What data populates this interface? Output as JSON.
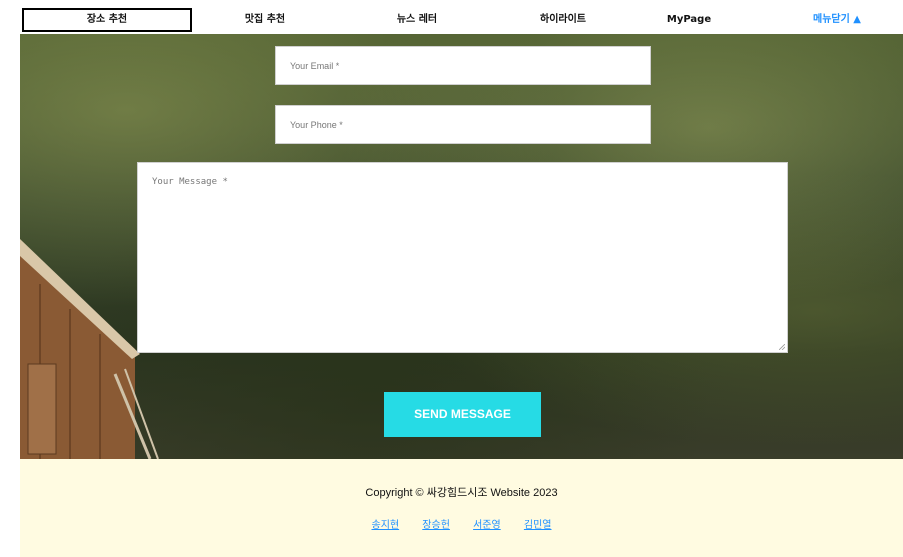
{
  "nav": {
    "items": [
      {
        "label": "장소 추천"
      },
      {
        "label": "맛집 추천"
      },
      {
        "label": "뉴스 레터"
      },
      {
        "label": "하이라이트"
      },
      {
        "label": "MyPage"
      },
      {
        "label": "메뉴닫기 ▲"
      }
    ],
    "active_index": 0,
    "close_color": "#1e90ff"
  },
  "form": {
    "email_placeholder": "Your Email *",
    "phone_placeholder": "Your Phone *",
    "message_placeholder": "Your Message *",
    "send_label": "SEND MESSAGE",
    "button_color": "#26dbe5"
  },
  "footer": {
    "copyright": "Copyright © 싸강힘드시조 Website 2023",
    "members": [
      "송지현",
      "장승헌",
      "서준영",
      "김민열"
    ],
    "background": "#fffbe1"
  }
}
